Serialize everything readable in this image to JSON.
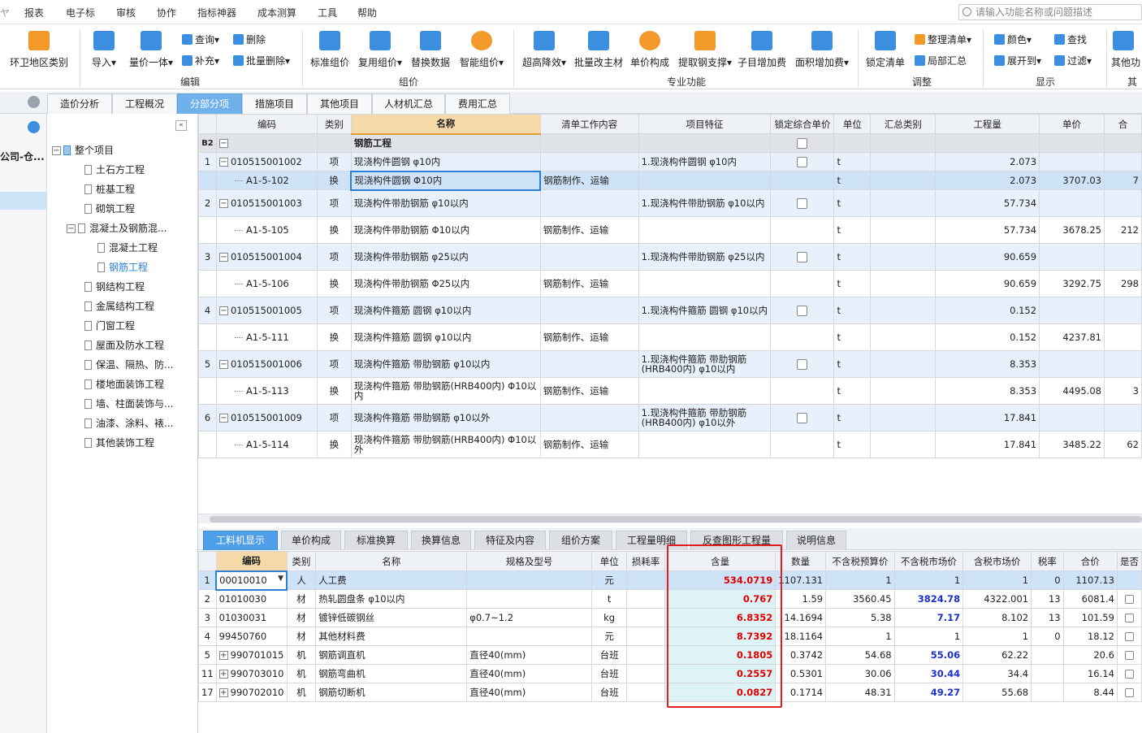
{
  "menu": {
    "items": [
      "报表",
      "电子标",
      "审核",
      "协作",
      "指标神器",
      "成本测算",
      "工具",
      "帮助"
    ],
    "search_placeholder": "请输入功能名称或问题描述"
  },
  "ribbon": {
    "region_label": "环卫地区类别",
    "import_label": "导入",
    "unit_price_label": "量价一体",
    "query_label": "查询",
    "supplement_label": "补充",
    "delete_label": "删除",
    "batch_delete_label": "批量删除",
    "standard_group_label": "标准组价",
    "reuse_group_label": "复用组价",
    "replace_data_label": "替换数据",
    "smart_group_label": "智能组价",
    "super_reduce_label": "超高降效",
    "batch_main_label": "批量改主材",
    "unit_composition_label": "单价构成",
    "steel_support_label": "提取钢支撑",
    "subitem_add_label": "子目增加费",
    "area_add_label": "面积增加费",
    "lock_list_label": "锁定清单",
    "organize_list_label": "整理清单",
    "local_summary_label": "局部汇总",
    "color_label": "颜色",
    "find_label": "查找",
    "expand_label": "展开到",
    "filter_label": "过滤",
    "other_label": "其他功",
    "groups": {
      "edit": "编辑",
      "group_price": "组价",
      "special": "专业功能",
      "adjust": "调整",
      "display": "显示",
      "other": "其"
    }
  },
  "tabs": [
    "造价分析",
    "工程概况",
    "分部分项",
    "措施项目",
    "其他项目",
    "人材机汇总",
    "费用汇总"
  ],
  "left": {
    "company": "公司-仓...",
    "tree_root": "整个项目",
    "tree_items": [
      "土石方工程",
      "桩基工程",
      "砌筑工程",
      "混凝土及钢筋混...",
      "混凝土工程",
      "钢筋工程",
      "钢结构工程",
      "金属结构工程",
      "门窗工程",
      "屋面及防水工程",
      "保温、隔热、防...",
      "楼地面装饰工程",
      "墙、柱面装饰与...",
      "油漆、涂料、裱...",
      "其他装饰工程"
    ]
  },
  "top_grid": {
    "headers": [
      "编码",
      "类别",
      "名称",
      "清单工作内容",
      "项目特征",
      "锁定综合单价",
      "单位",
      "汇总类别",
      "工程量",
      "单价",
      "合"
    ],
    "section": {
      "label": "B2",
      "name": "钢筋工程"
    },
    "rows": [
      {
        "no": "1",
        "code": "010515001002",
        "type": "项",
        "name": "现浇构件圆钢 φ10内",
        "work": "",
        "feature": "1.现浇构件圆钢 φ10内",
        "unit": "t",
        "qty": "2.073",
        "price": "",
        "total": ""
      },
      {
        "no": "",
        "code": "A1-5-102",
        "type": "换",
        "name": "现浇构件圆钢 Φ10内",
        "work": "钢筋制作、运输",
        "feature": "",
        "unit": "t",
        "qty": "2.073",
        "price": "3707.03",
        "total": "7"
      },
      {
        "no": "2",
        "code": "010515001003",
        "type": "项",
        "name": "现浇构件带肋钢筋 φ10以内",
        "work": "",
        "feature": "1.现浇构件带肋钢筋 φ10以内",
        "unit": "t",
        "qty": "57.734",
        "price": "",
        "total": ""
      },
      {
        "no": "",
        "code": "A1-5-105",
        "type": "换",
        "name": "现浇构件带肋钢筋 Φ10以内",
        "work": "钢筋制作、运输",
        "feature": "",
        "unit": "t",
        "qty": "57.734",
        "price": "3678.25",
        "total": "212"
      },
      {
        "no": "3",
        "code": "010515001004",
        "type": "项",
        "name": "现浇构件带肋钢筋 φ25以内",
        "work": "",
        "feature": "1.现浇构件带肋钢筋 φ25以内",
        "unit": "t",
        "qty": "90.659",
        "price": "",
        "total": ""
      },
      {
        "no": "",
        "code": "A1-5-106",
        "type": "换",
        "name": "现浇构件带肋钢筋 Φ25以内",
        "work": "钢筋制作、运输",
        "feature": "",
        "unit": "t",
        "qty": "90.659",
        "price": "3292.75",
        "total": "298"
      },
      {
        "no": "4",
        "code": "010515001005",
        "type": "项",
        "name": "现浇构件箍筋 圆钢 φ10以内",
        "work": "",
        "feature": "1.现浇构件箍筋 圆钢 φ10以内",
        "unit": "t",
        "qty": "0.152",
        "price": "",
        "total": ""
      },
      {
        "no": "",
        "code": "A1-5-111",
        "type": "换",
        "name": "现浇构件箍筋 圆钢 φ10以内",
        "work": "钢筋制作、运输",
        "feature": "",
        "unit": "t",
        "qty": "0.152",
        "price": "4237.81",
        "total": ""
      },
      {
        "no": "5",
        "code": "010515001006",
        "type": "项",
        "name": "现浇构件箍筋 带肋钢筋 φ10以内",
        "work": "",
        "feature": "1.现浇构件箍筋 带肋钢筋(HRB400内) φ10以内",
        "unit": "t",
        "qty": "8.353",
        "price": "",
        "total": ""
      },
      {
        "no": "",
        "code": "A1-5-113",
        "type": "换",
        "name": "现浇构件箍筋 带肋钢筋(HRB400内) Φ10以内",
        "work": "钢筋制作、运输",
        "feature": "",
        "unit": "t",
        "qty": "8.353",
        "price": "4495.08",
        "total": "3"
      },
      {
        "no": "6",
        "code": "010515001009",
        "type": "项",
        "name": "现浇构件箍筋 带肋钢筋 φ10以外",
        "work": "",
        "feature": "1.现浇构件箍筋 带肋钢筋(HRB400内) φ10以外",
        "unit": "t",
        "qty": "17.841",
        "price": "",
        "total": ""
      },
      {
        "no": "",
        "code": "A1-5-114",
        "type": "换",
        "name": "现浇构件箍筋 带肋钢筋(HRB400内) Φ10以外",
        "work": "钢筋制作、运输",
        "feature": "",
        "unit": "t",
        "qty": "17.841",
        "price": "3485.22",
        "total": "62"
      }
    ]
  },
  "bottom_tabs": [
    "工料机显示",
    "单价构成",
    "标准换算",
    "换算信息",
    "特征及内容",
    "组价方案",
    "工程量明细",
    "反查图形工程量",
    "说明信息"
  ],
  "bottom_grid": {
    "headers": [
      "编码",
      "类别",
      "名称",
      "规格及型号",
      "单位",
      "损耗率",
      "含量",
      "数量",
      "不含税预算价",
      "不含税市场价",
      "含税市场价",
      "税率",
      "合价",
      "是否"
    ],
    "rows": [
      {
        "no": "1",
        "code": "00010010",
        "type": "人",
        "name": "人工费",
        "spec": "",
        "unit": "元",
        "loss": "",
        "content": "534.0719",
        "qty": "1107.131",
        "pre": "1",
        "mkt": "1",
        "taxmkt": "1",
        "rate": "0",
        "total": "1107.13"
      },
      {
        "no": "2",
        "code": "01010030",
        "type": "材",
        "name": "热轧圆盘条 φ10以内",
        "spec": "",
        "unit": "t",
        "loss": "",
        "content": "0.767",
        "qty": "1.59",
        "pre": "3560.45",
        "mkt": "3824.78",
        "taxmkt": "4322.001",
        "rate": "13",
        "total": "6081.4"
      },
      {
        "no": "3",
        "code": "01030031",
        "type": "材",
        "name": "镀锌低碳钢丝",
        "spec": "φ0.7~1.2",
        "unit": "kg",
        "loss": "",
        "content": "6.8352",
        "qty": "14.1694",
        "pre": "5.38",
        "mkt": "7.17",
        "taxmkt": "8.102",
        "rate": "13",
        "total": "101.59"
      },
      {
        "no": "4",
        "code": "99450760",
        "type": "材",
        "name": "其他材料费",
        "spec": "",
        "unit": "元",
        "loss": "",
        "content": "8.7392",
        "qty": "18.1164",
        "pre": "1",
        "mkt": "1",
        "taxmkt": "1",
        "rate": "0",
        "total": "18.12"
      },
      {
        "no": "5",
        "code": "990701015",
        "type": "机",
        "name": "钢筋调直机",
        "spec": "直径40(mm)",
        "unit": "台班",
        "loss": "",
        "content": "0.1805",
        "qty": "0.3742",
        "pre": "54.68",
        "mkt": "55.06",
        "taxmkt": "62.22",
        "rate": "",
        "total": "20.6"
      },
      {
        "no": "11",
        "code": "990703010",
        "type": "机",
        "name": "钢筋弯曲机",
        "spec": "直径40(mm)",
        "unit": "台班",
        "loss": "",
        "content": "0.2557",
        "qty": "0.5301",
        "pre": "30.06",
        "mkt": "30.44",
        "taxmkt": "34.4",
        "rate": "",
        "total": "16.14"
      },
      {
        "no": "17",
        "code": "990702010",
        "type": "机",
        "name": "钢筋切断机",
        "spec": "直径40(mm)",
        "unit": "台班",
        "loss": "",
        "content": "0.0827",
        "qty": "0.1714",
        "pre": "48.31",
        "mkt": "49.27",
        "taxmkt": "55.68",
        "rate": "",
        "total": "8.44"
      }
    ]
  },
  "colors": {
    "accent": "#4f9fe8",
    "highlight_box": "#e02020",
    "content_value": "#e00000",
    "market_value": "#1a2fd0"
  }
}
